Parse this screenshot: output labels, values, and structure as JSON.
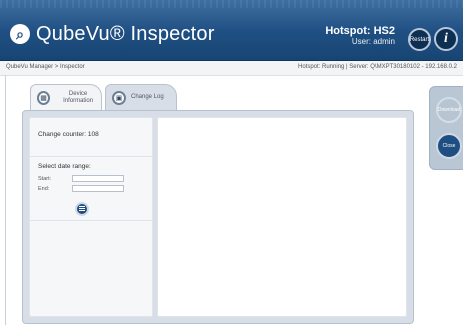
{
  "header": {
    "app_title": "QubeVu® Inspector",
    "hotspot": "Hotspot: HS2",
    "user": "User: admin",
    "restart_label": "Restart",
    "info_glyph": "i",
    "logo_icon": "magnifier-icon"
  },
  "breadcrumb": {
    "left": "QubeVu Manager > Inspector",
    "right": "Hotspot: Running | Server: Q\\MXPT30180102 - 192.168.0.2"
  },
  "tabs": [
    {
      "label": "Device Information",
      "icon": "device-icon",
      "active": false
    },
    {
      "label": "Change Log",
      "icon": "log-icon",
      "active": true
    }
  ],
  "left_panel": {
    "change_counter": "Change counter: 108",
    "select_title": "Select date range:",
    "start_label": "Start:",
    "end_label": "End:",
    "start_value": "",
    "end_value": ""
  },
  "side_actions": {
    "download_label": "Download",
    "close_label": "Close"
  },
  "colors": {
    "header": "#1f4f82",
    "panel": "#d7dee7",
    "accent": "#1f4f82"
  }
}
